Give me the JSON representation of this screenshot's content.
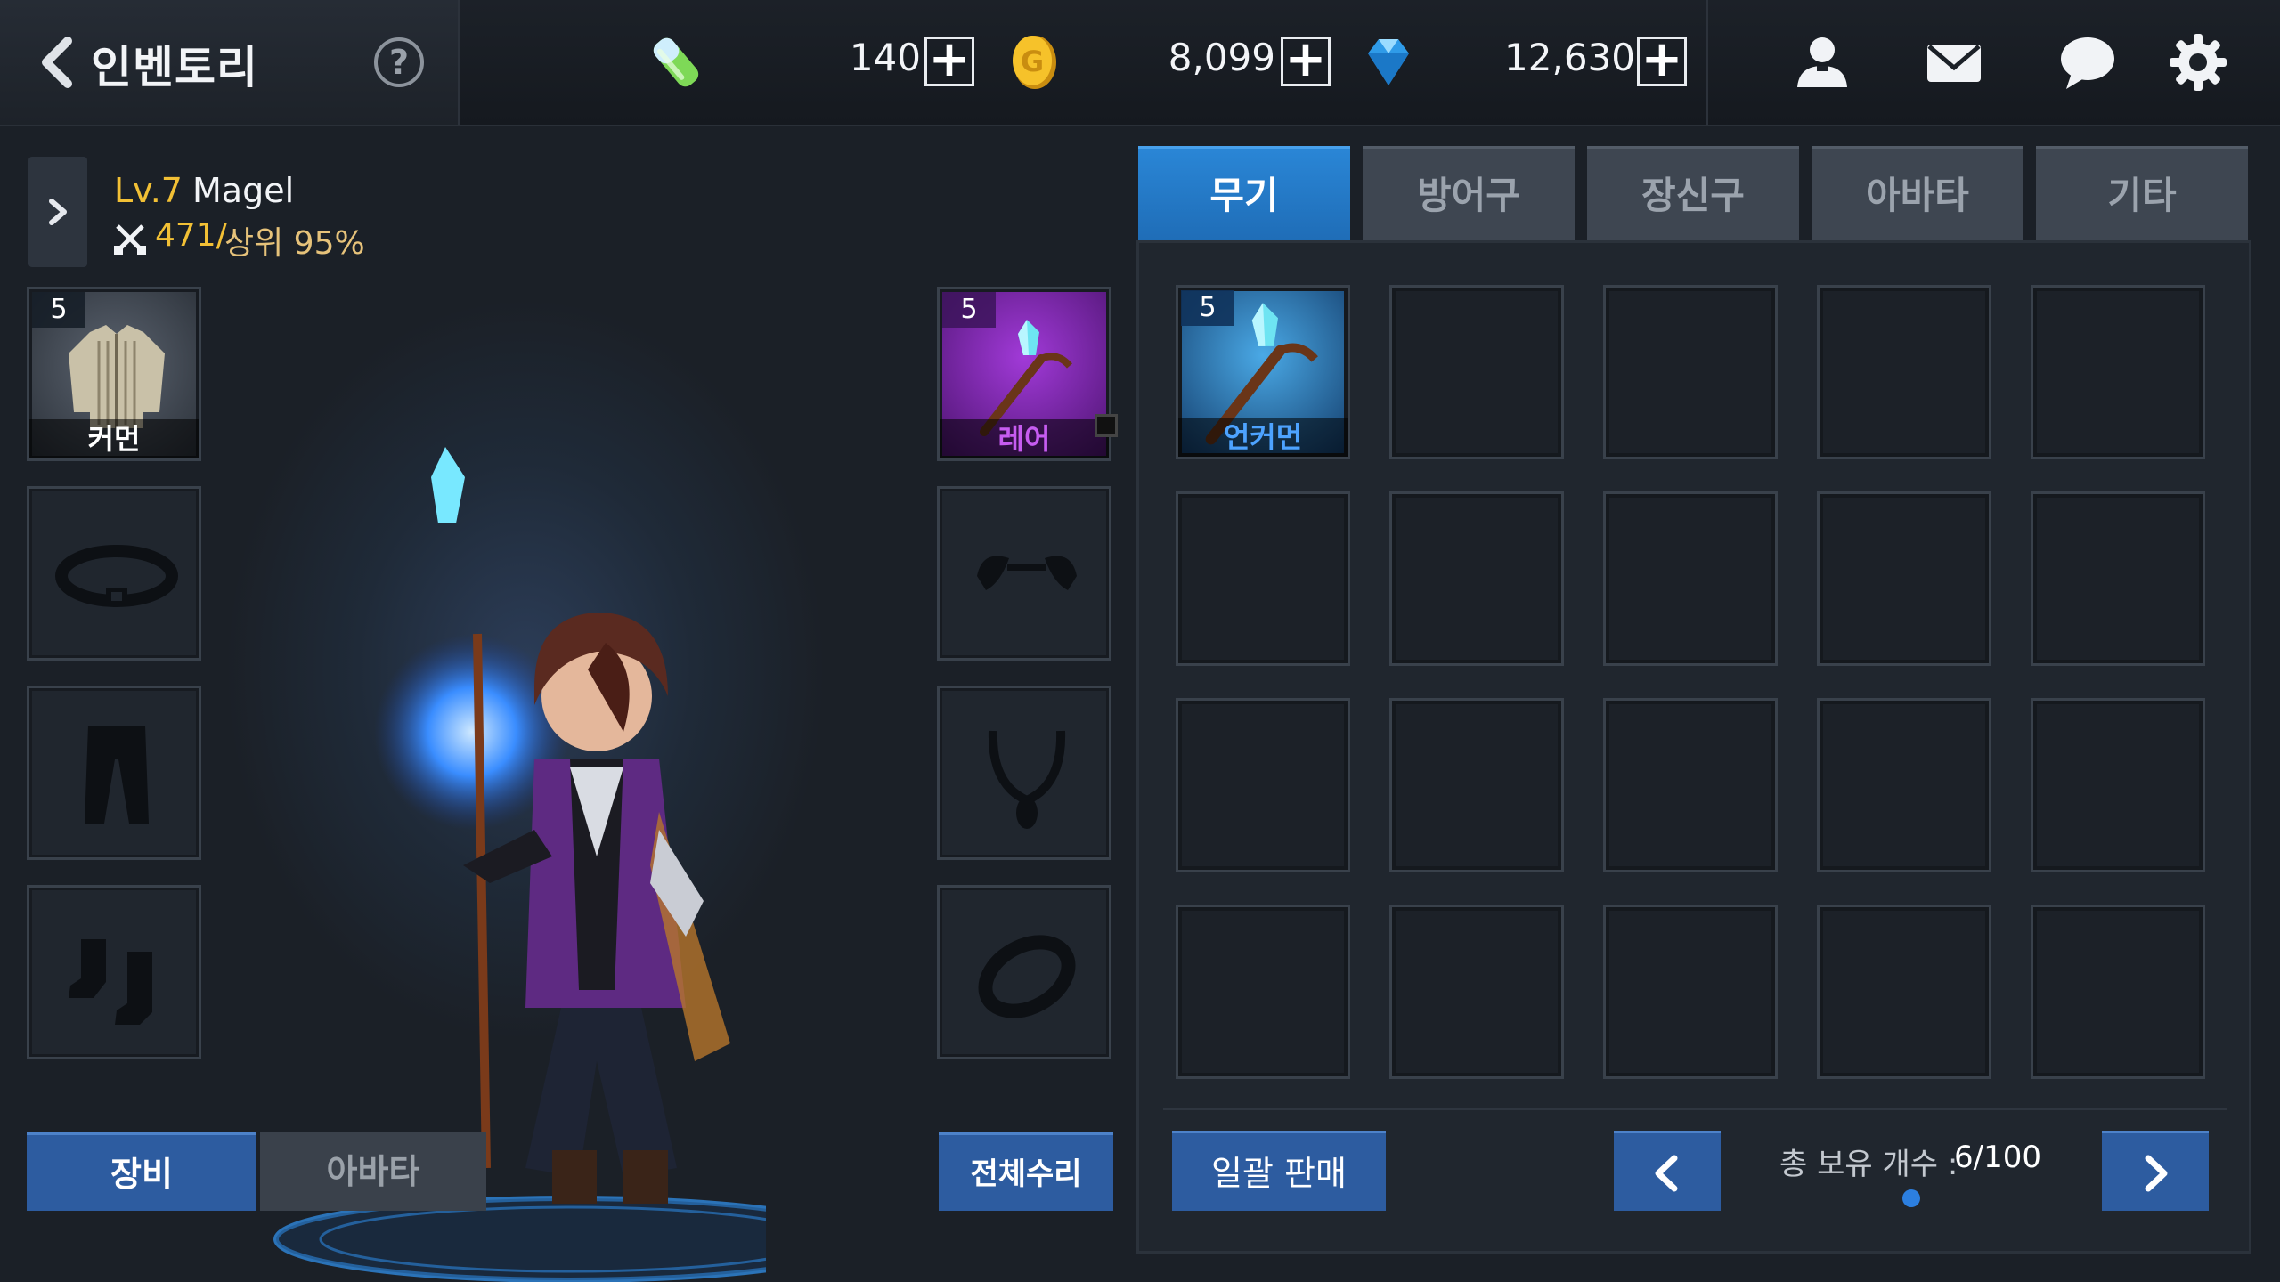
{
  "header": {
    "title": "인벤토리",
    "help": "?",
    "stamina_value": "140",
    "gold_value": "8,099",
    "gem_value": "12,630",
    "plus": "+"
  },
  "character": {
    "level": "Lv.7",
    "name": "Magel",
    "combat_power": "471/",
    "rank": "상위 95%"
  },
  "equipment": {
    "armor": {
      "level": "5",
      "grade": "커먼",
      "grade_color": "#ffffff"
    },
    "weapon": {
      "level": "5",
      "grade": "레어",
      "grade_color": "#c65cf0"
    }
  },
  "bottom_left": {
    "equip_tab": "장비",
    "avatar_tab": "아바타",
    "repair": "전체수리"
  },
  "inventory": {
    "tabs": [
      "무기",
      "방어구",
      "장신구",
      "아바타",
      "기타"
    ],
    "active_tab": 0,
    "items": [
      {
        "level": "5",
        "grade": "언커먼",
        "grade_color": "#4da3ff"
      }
    ],
    "sell_all": "일괄 판매",
    "count_label": "총 보유 개수 :",
    "count_value": "6/100"
  },
  "colors": {
    "accent_blue": "#2d5ca0",
    "tab_active": "#2a86d6",
    "gold_text": "#f2c035"
  }
}
